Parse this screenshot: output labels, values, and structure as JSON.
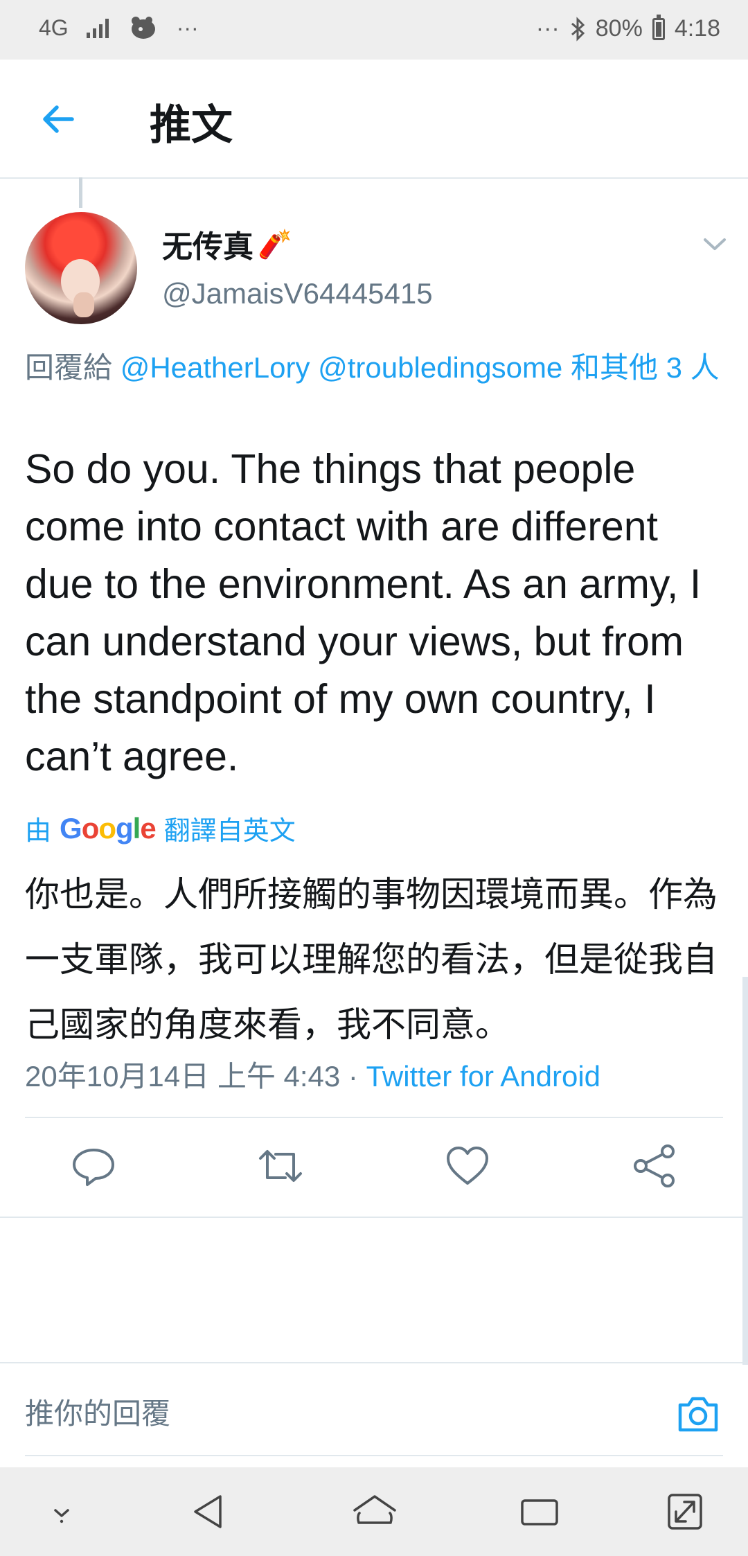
{
  "status_bar": {
    "network": "4G",
    "more_left": "···",
    "more_right": "···",
    "battery": "80%",
    "battery_level": 0.8,
    "time": "4:18"
  },
  "header": {
    "title": "推文",
    "back_icon": "arrow-left-icon"
  },
  "tweet": {
    "display_name": "无传真",
    "name_emoji": "🧨",
    "handle": "@JamaisV64445415",
    "reply_prefix": "回覆給",
    "reply_mentions": [
      "@HeatherLory",
      "@troubledingsome",
      "和其他 3 人"
    ],
    "text": "So do you.  The things that people come into contact with are different due to the environment. As an army, I can understand your views, but from the standpoint of my own country, I can’t agree.",
    "translate_by": "由",
    "translate_provider": "Google",
    "translate_from": "翻譯自英文",
    "translated_text": "你也是。人們所接觸的事物因環境而異。作為一支軍隊，我可以理解您的看法，但是從我自己國家的角度來看，我不同意。",
    "timestamp": "20年10月14日 上午 4:43",
    "separator": " · ",
    "source": "Twitter for Android"
  },
  "actions": {
    "icons": [
      "reply-icon",
      "retweet-icon",
      "like-icon",
      "share-icon"
    ]
  },
  "reply_box": {
    "placeholder": "推你的回覆",
    "camera_icon": "camera-icon"
  },
  "colors": {
    "accent": "#1da1f2",
    "secondary_text": "#657786",
    "primary_text": "#14171a",
    "divider": "#e1e8ed",
    "system_bar": "#eeeeee"
  }
}
